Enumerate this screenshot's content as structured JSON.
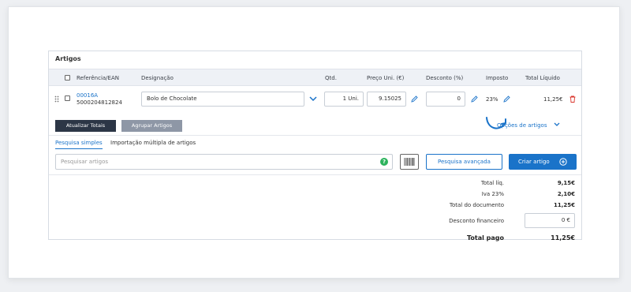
{
  "panel": {
    "title": "Artigos"
  },
  "columns": {
    "ref": "Referência/EAN",
    "designacao": "Designação",
    "qtd": "Qtd.",
    "preco": "Preço Uni. (€)",
    "desconto": "Desconto (%)",
    "imposto": "Imposto",
    "total": "Total Líquido"
  },
  "item": {
    "ref": "00016A",
    "ean": "5000204812824",
    "designacao": "Bolo de Chocolate",
    "qtd": "1 Uni.",
    "preco": "9.15025",
    "desconto": "0",
    "imposto": "23%",
    "total": "11,25€"
  },
  "actions": {
    "atualizar": "Atualizar Totais",
    "agrupar": "Agrupar Artigos",
    "opcoes": "Opções de artigos"
  },
  "tabs": {
    "simple": "Pesquisa simples",
    "multiple": "Importação múltipla de artigos"
  },
  "search": {
    "placeholder": "Pesquisar artigos",
    "advanced": "Pesquisa avançada",
    "create": "Criar artigo"
  },
  "totals": {
    "liq_label": "Total líq.",
    "liq_value": "9,15€",
    "iva_label": "Iva 23%",
    "iva_value": "2,10€",
    "doc_label": "Total do documento",
    "doc_value": "11,25€",
    "desc_label": "Desconto financeiro",
    "desc_value": "0 €",
    "paid_label": "Total pago",
    "paid_value": "11,25€"
  },
  "colors": {
    "accent": "#1a73c9",
    "dark": "#2c3646",
    "green": "#2db35d",
    "red": "#d9342b"
  }
}
